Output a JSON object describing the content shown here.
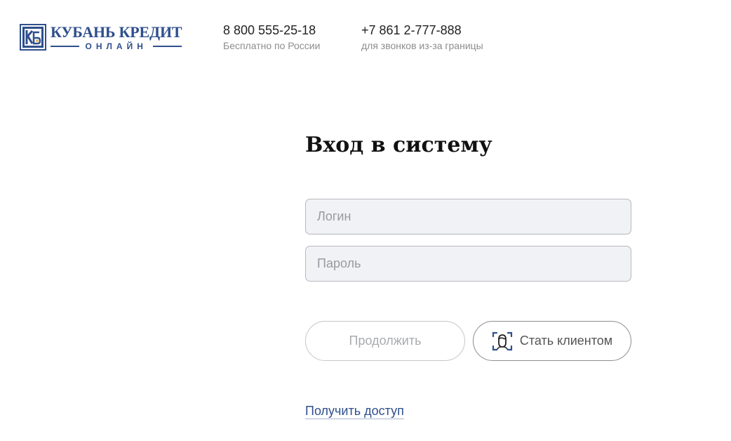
{
  "brand": {
    "name": "КУБАНЬ КРЕДИТ",
    "subtitle": "ОНЛАЙН",
    "color": "#2f4f8d"
  },
  "contacts": [
    {
      "number": "8 800 555-25-18",
      "note": "Бесплатно по России"
    },
    {
      "number": "+7 861 2-777-888",
      "note": "для звонков из-за границы"
    }
  ],
  "login_form": {
    "title": "Вход в систему",
    "login_placeholder": "Логин",
    "password_placeholder": "Пароль",
    "continue_label": "Продолжить",
    "become_client_label": "Стать клиентом",
    "become_client_icon": "face-id-icon",
    "get_access_link": "Получить доступ"
  }
}
